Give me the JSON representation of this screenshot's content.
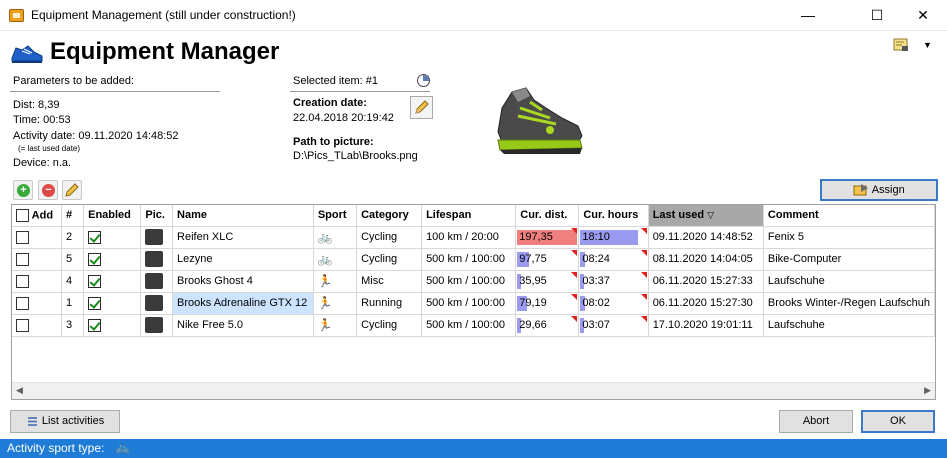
{
  "window": {
    "title": "Equipment Management (still under construction!)",
    "minimize": "—",
    "maximize": "☐",
    "close": "✕"
  },
  "header": {
    "title": "Equipment Manager"
  },
  "params": {
    "title": "Parameters to be added:",
    "dist": "Dist: 8,39",
    "time": "Time: 00:53",
    "activity_date": "Activity date: 09.11.2020 14:48:52",
    "last_used_note": "(= last used date)",
    "device": "Device: n.a."
  },
  "selected": {
    "label": "Selected item: #1",
    "creation_label": "Creation date:",
    "creation_value": "22.04.2018 20:19:42",
    "path_label": "Path to picture:",
    "path_value": "D:\\Pics_TLab\\Brooks.png"
  },
  "toolbar": {
    "assign": "Assign"
  },
  "table": {
    "columns": [
      "Add",
      "#",
      "Enabled",
      "Pic.",
      "Name",
      "Sport",
      "Category",
      "Lifespan",
      "Cur. dist.",
      "Cur. hours",
      "Last used",
      "Comment"
    ],
    "sorted_column": "Last used",
    "rows": [
      {
        "add": false,
        "num": "2",
        "enabled": true,
        "name": "Reifen XLC",
        "sport": "cycling",
        "category": "Cycling",
        "lifespan": "100 km / 20:00",
        "dist": "197,35",
        "dist_fill": 1.0,
        "dist_color": "#f08080",
        "hours": "18:10",
        "hours_fill": 1.0,
        "hours_color": "#9a9af0",
        "last_used": "09.11.2020 14:48:52",
        "comment": "Fenix 5",
        "highlight": false
      },
      {
        "add": false,
        "num": "5",
        "enabled": true,
        "name": "Lezyne",
        "sport": "cycling",
        "category": "Cycling",
        "lifespan": "500 km / 100:00",
        "dist": "97,75",
        "dist_fill": 0.2,
        "dist_color": "#9a9af0",
        "hours": "08:24",
        "hours_fill": 0.08,
        "hours_color": "#9a9af0",
        "last_used": "08.11.2020 14:04:05",
        "comment": "Bike-Computer",
        "highlight": false
      },
      {
        "add": false,
        "num": "4",
        "enabled": true,
        "name": "Brooks Ghost 4",
        "sport": "running",
        "category": "Misc",
        "lifespan": "500 km / 100:00",
        "dist": "35,95",
        "dist_fill": 0.07,
        "dist_color": "#9a9af0",
        "hours": "03:37",
        "hours_fill": 0.04,
        "hours_color": "#9a9af0",
        "last_used": "06.11.2020 15:27:33",
        "comment": "Laufschuhe",
        "highlight": false
      },
      {
        "add": false,
        "num": "1",
        "enabled": true,
        "name": "Brooks Adrenaline GTX 12",
        "sport": "running",
        "category": "Running",
        "lifespan": "500 km / 100:00",
        "dist": "79,19",
        "dist_fill": 0.16,
        "dist_color": "#9a9af0",
        "hours": "08:02",
        "hours_fill": 0.08,
        "hours_color": "#9a9af0",
        "last_used": "06.11.2020 15:27:30",
        "comment": "Brooks Winter-/Regen Laufschuh",
        "highlight": true
      },
      {
        "add": false,
        "num": "3",
        "enabled": true,
        "name": "Nike Free 5.0",
        "sport": "running",
        "category": "Cycling",
        "lifespan": "500 km / 100:00",
        "dist": "29,66",
        "dist_fill": 0.06,
        "dist_color": "#9a9af0",
        "hours": "03:07",
        "hours_fill": 0.03,
        "hours_color": "#9a9af0",
        "last_used": "17.10.2020 19:01:11",
        "comment": "Laufschuhe",
        "highlight": false
      }
    ]
  },
  "footer": {
    "list_activities": "List activities",
    "abort": "Abort",
    "ok": "OK"
  },
  "status": {
    "label": "Activity sport type:",
    "icon": "cycling-icon"
  }
}
